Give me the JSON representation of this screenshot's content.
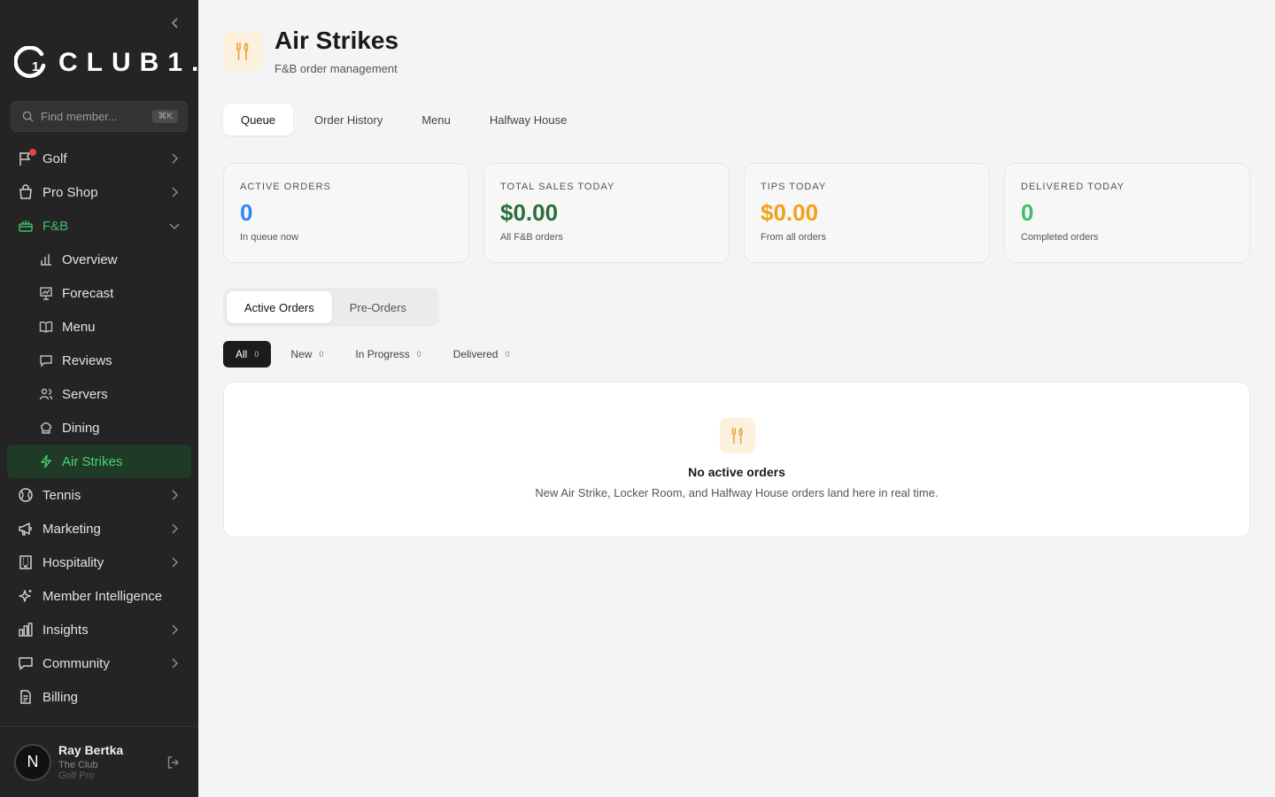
{
  "brand": {
    "name": "CLUB1.",
    "logo_mark": "1"
  },
  "colors": {
    "accent_green": "#3fbf68",
    "blue": "#2f86f6",
    "dark_green": "#2a6e3c",
    "orange": "#f3a11b",
    "icon_orange": "#e8a43b"
  },
  "search": {
    "placeholder": "Find member...",
    "shortcut": "⌘K"
  },
  "sidebar": {
    "items": [
      {
        "label": "Golf",
        "icon": "flag-icon"
      },
      {
        "label": "Pro Shop",
        "icon": "shopping-bag-icon"
      },
      {
        "label": "F&B",
        "icon": "food-tray-icon"
      },
      {
        "label": "Tennis",
        "icon": "tennis-ball-icon"
      },
      {
        "label": "Marketing",
        "icon": "megaphone-icon"
      },
      {
        "label": "Hospitality",
        "icon": "building-icon"
      },
      {
        "label": "Member Intelligence",
        "icon": "sparkles-icon"
      },
      {
        "label": "Insights",
        "icon": "bar-chart-icon"
      },
      {
        "label": "Community",
        "icon": "chat-bubble-icon"
      },
      {
        "label": "Billing",
        "icon": "document-icon"
      }
    ],
    "fb_children": [
      {
        "label": "Overview",
        "icon": "bar-chart-icon"
      },
      {
        "label": "Forecast",
        "icon": "presentation-icon"
      },
      {
        "label": "Menu",
        "icon": "book-icon"
      },
      {
        "label": "Reviews",
        "icon": "chat-bubble-icon"
      },
      {
        "label": "Servers",
        "icon": "users-icon"
      },
      {
        "label": "Dining",
        "icon": "chef-hat-icon"
      },
      {
        "label": "Air Strikes",
        "icon": "lightning-icon"
      }
    ]
  },
  "user": {
    "initial": "N",
    "name": "Ray Bertka",
    "club": "The Club",
    "role": "Golf Pro"
  },
  "page": {
    "title": "Air Strikes",
    "subtitle": "F&B order management"
  },
  "tabs": [
    "Queue",
    "Order History",
    "Menu",
    "Halfway House"
  ],
  "stats": [
    {
      "label": "ACTIVE ORDERS",
      "value": "0",
      "sub": "In queue now",
      "color": "#2f86f6"
    },
    {
      "label": "TOTAL SALES TODAY",
      "value": "$0.00",
      "sub": "All F&B orders",
      "color": "#2a6e3c"
    },
    {
      "label": "TIPS TODAY",
      "value": "$0.00",
      "sub": "From all orders",
      "color": "#f3a11b"
    },
    {
      "label": "DELIVERED TODAY",
      "value": "0",
      "sub": "Completed orders",
      "color": "#3fbf68"
    }
  ],
  "order_segments": [
    "Active Orders",
    "Pre-Orders"
  ],
  "filters": [
    {
      "label": "All",
      "count": "0"
    },
    {
      "label": "New",
      "count": "0"
    },
    {
      "label": "In Progress",
      "count": "0"
    },
    {
      "label": "Delivered",
      "count": "0"
    }
  ],
  "empty_state": {
    "title": "No active orders",
    "text": "New Air Strike, Locker Room, and Halfway House orders land here in real time."
  }
}
